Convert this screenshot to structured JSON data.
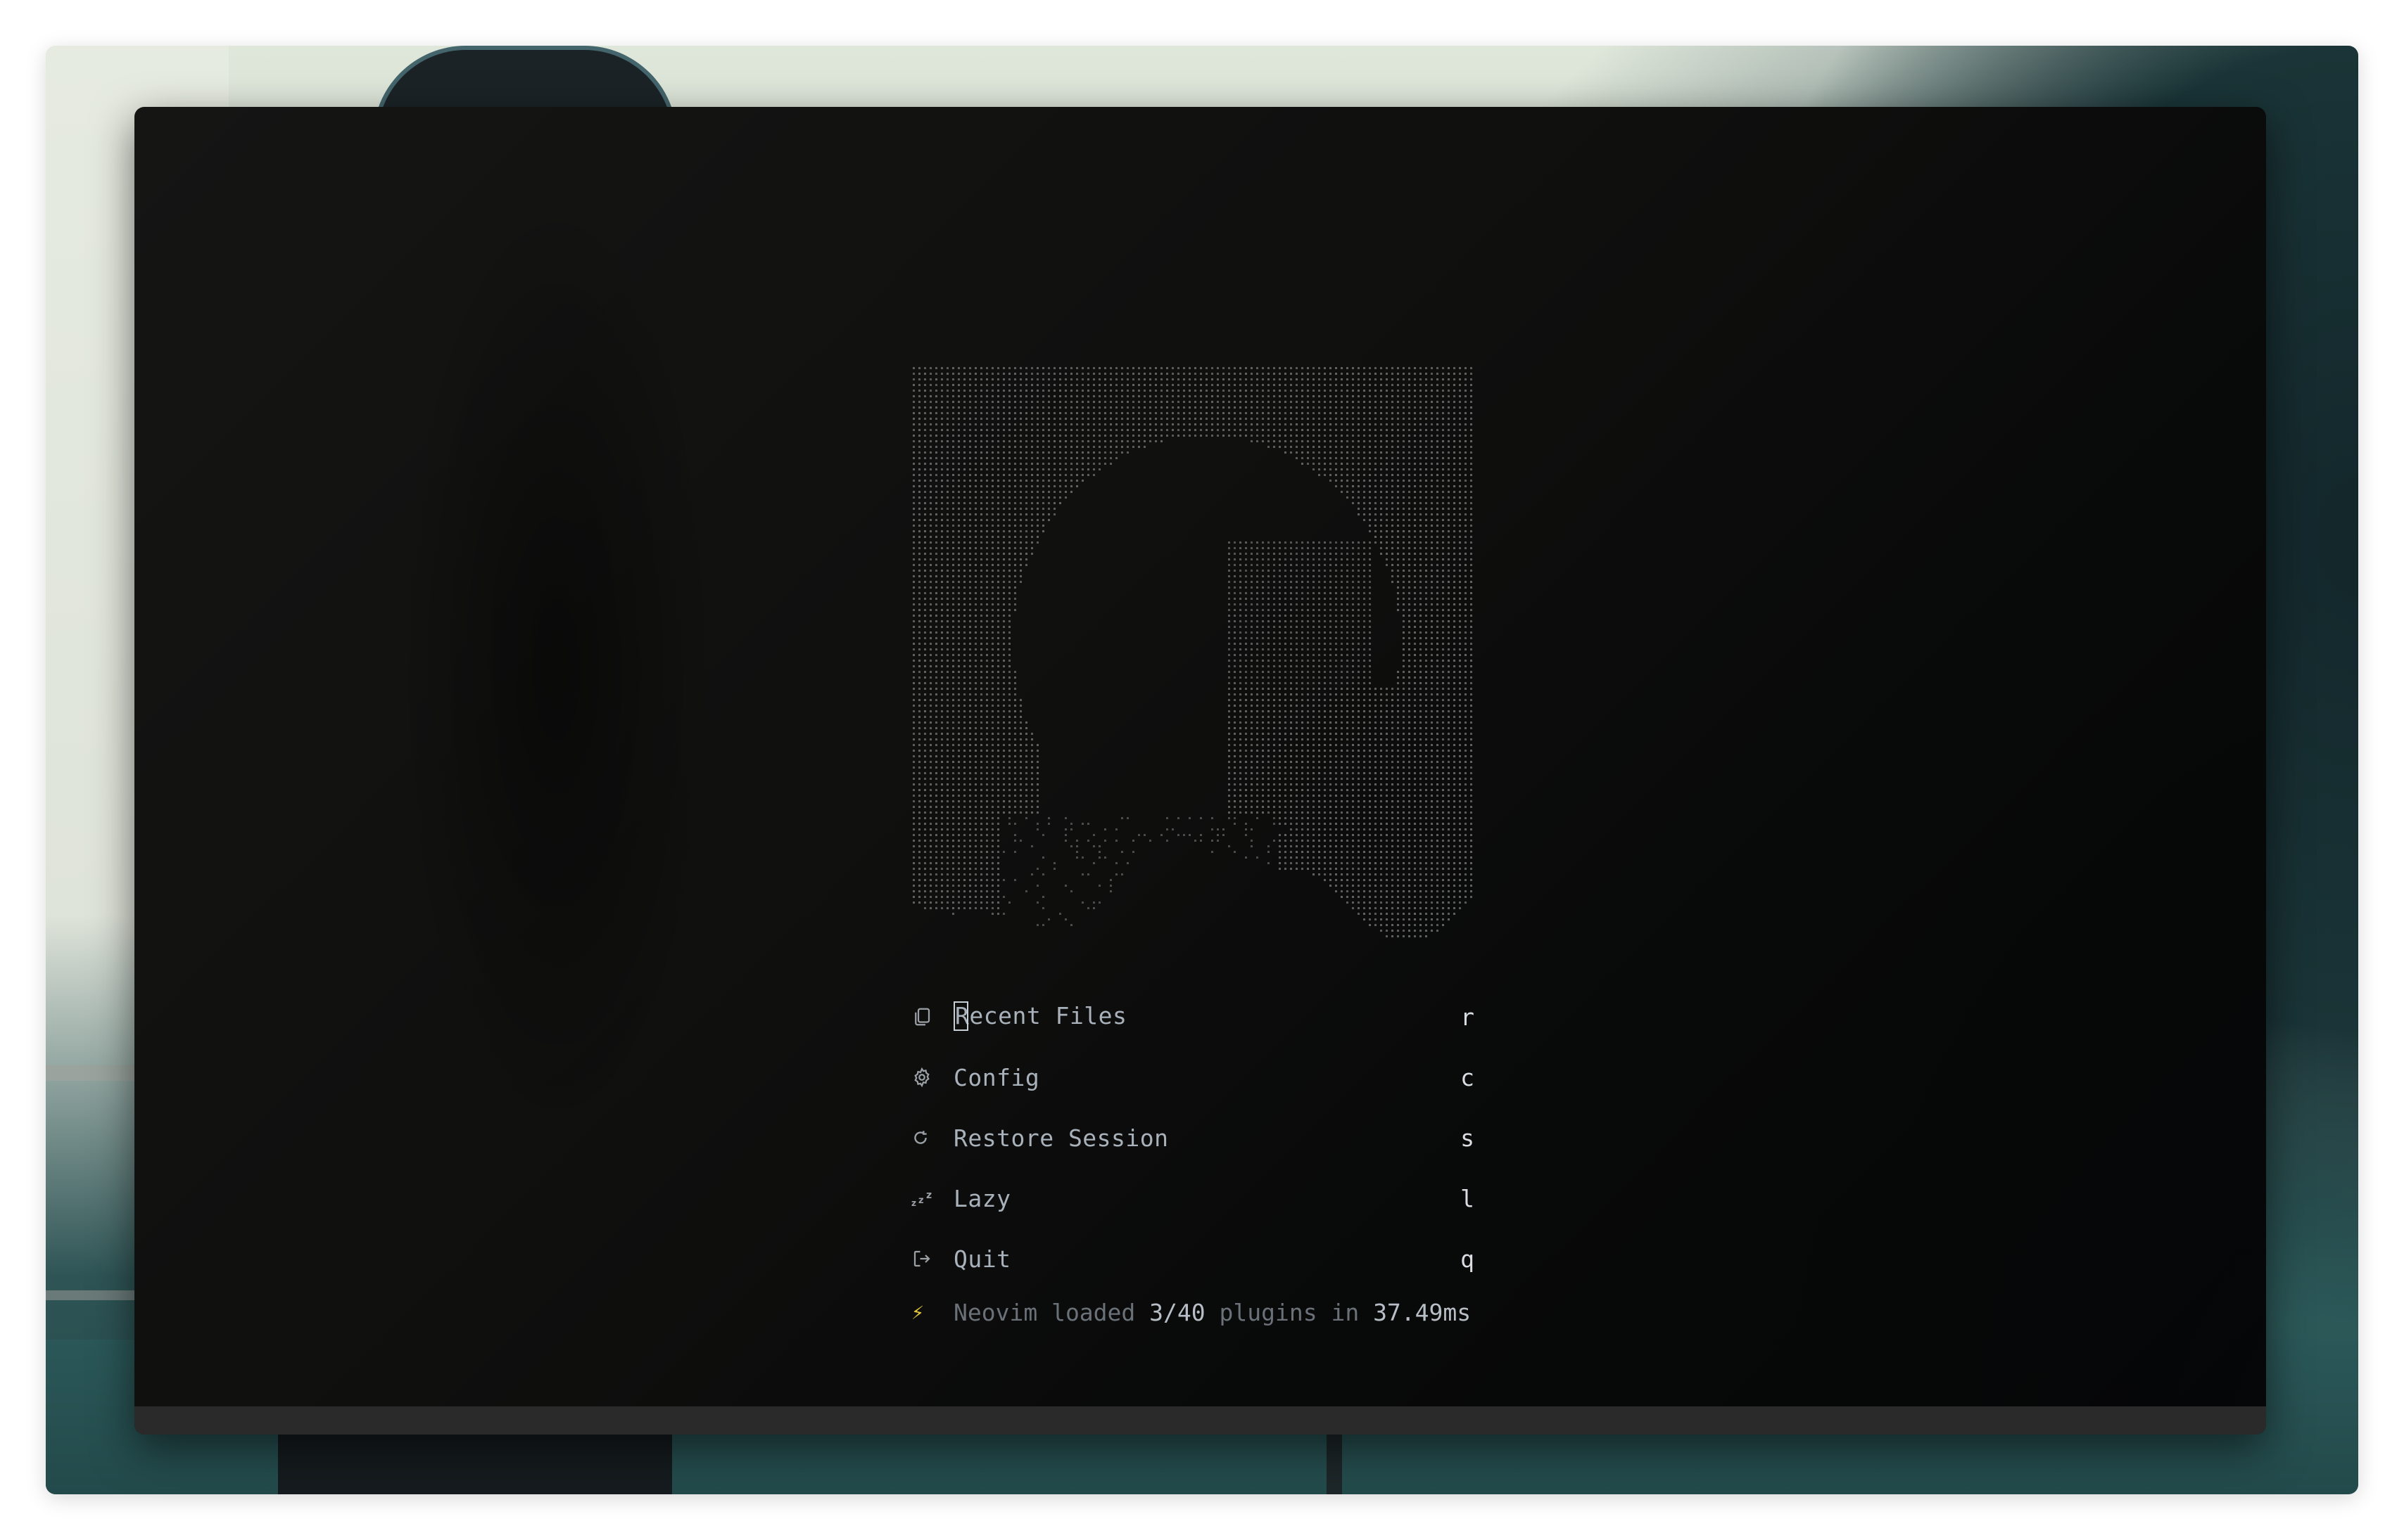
{
  "dashboard": {
    "menu": [
      {
        "icon": "files-icon",
        "label": "Recent Files",
        "key": "r"
      },
      {
        "icon": "gear-icon",
        "label": "Config",
        "key": "c"
      },
      {
        "icon": "restore-icon",
        "label": "Restore Session",
        "key": "s"
      },
      {
        "icon": "sleep-icon",
        "label": "Lazy",
        "key": "l"
      },
      {
        "icon": "exit-icon",
        "label": "Quit",
        "key": "q"
      }
    ],
    "footer": {
      "icon": "lightning-icon",
      "prefix": "Neovim loaded ",
      "loaded": "3/40",
      "middle": " plugins in ",
      "time": "37.49ms"
    }
  },
  "colors": {
    "terminal_bg": "#0f0f0e",
    "text": "#a9b1ba",
    "key": "#d8dde2",
    "footer_dim": "#6b7178",
    "bolt": "#e4c53a",
    "statusline": "#2a2a2a"
  }
}
